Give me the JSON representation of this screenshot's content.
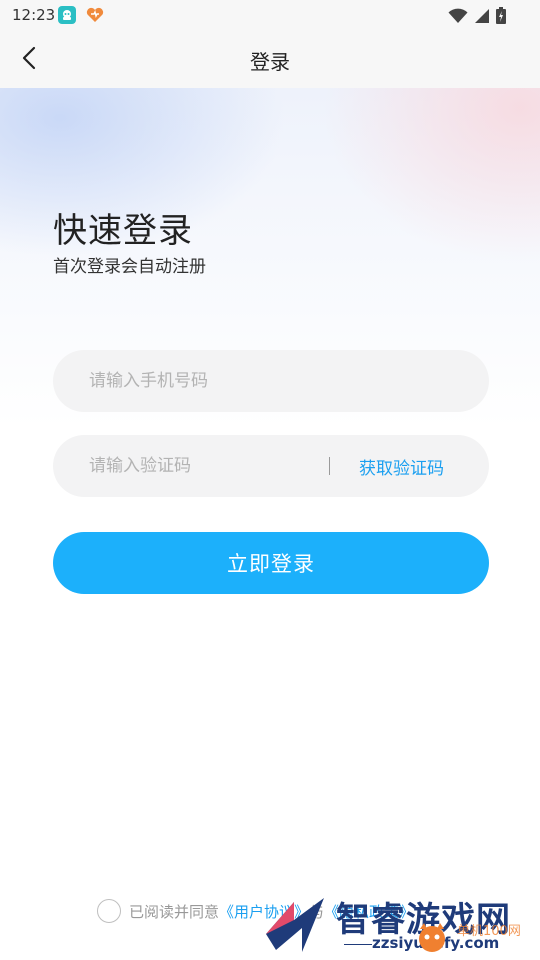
{
  "status_bar": {
    "time": "12:23"
  },
  "nav": {
    "title": "登录"
  },
  "hero": {
    "title": "快速登录",
    "subtitle": "首次登录会自动注册"
  },
  "form": {
    "phone_placeholder": "请输入手机号码",
    "phone_value": "",
    "code_placeholder": "请输入验证码",
    "code_value": "",
    "get_code_label": "获取验证码",
    "login_label": "立即登录"
  },
  "agreement": {
    "prefix": "已阅读并同意",
    "user_agreement_link": "《用户协议》",
    "conjunction": "与",
    "privacy_link": "《隐私政策》",
    "checked": false
  },
  "watermark": {
    "brand": "智睿游戏网",
    "url": "zzsiyuxefy.com",
    "secondary": "单机100网"
  },
  "colors": {
    "accent": "#1cb0fb",
    "link": "#1a9ff0",
    "field_bg": "#f3f3f4"
  },
  "icons": {
    "back": "chevron-left-icon",
    "wifi": "wifi-icon",
    "signal": "signal-icon",
    "battery": "battery-icon"
  }
}
